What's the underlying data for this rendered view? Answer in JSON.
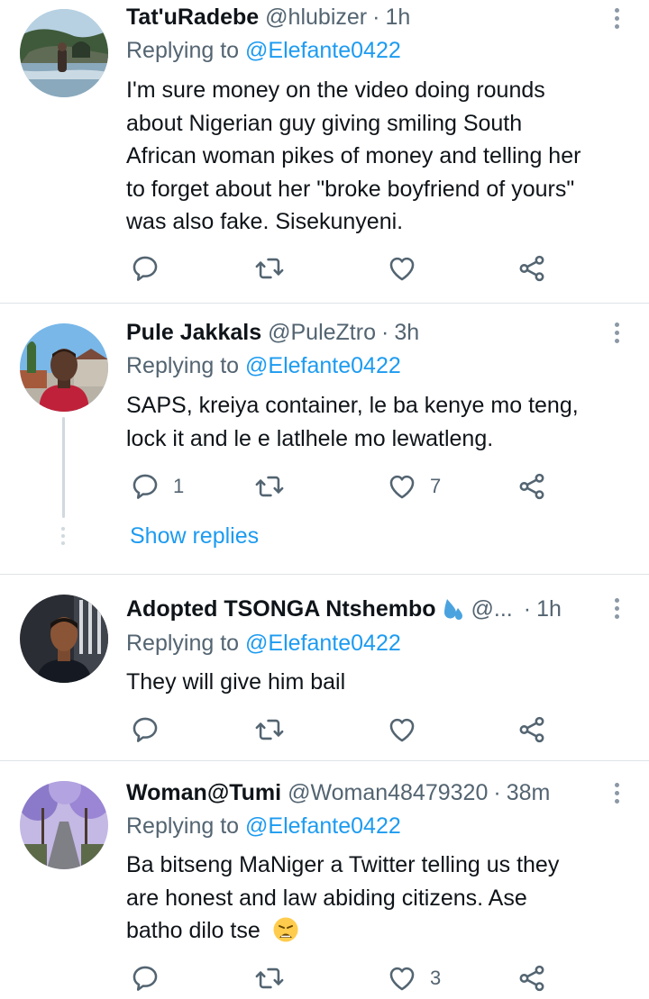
{
  "tweets": [
    {
      "name": "Tat'uRadebe",
      "handle": "@hlubizer",
      "separator": "·",
      "time": "1h",
      "replying_label": "Replying to",
      "replying_to": "@Elefante0422",
      "lines": [
        "I'm sure money on the video doing rounds",
        "about Nigerian guy giving smiling South",
        "African woman pikes of money and telling her",
        "to forget about her \"broke boyfriend of yours\"",
        "was also fake. Sisekunyeni."
      ],
      "reply_count": "",
      "like_count": ""
    },
    {
      "name": "Pule Jakkals",
      "handle": "@PuleZtro",
      "separator": "·",
      "time": "3h",
      "replying_label": "Replying to",
      "replying_to": "@Elefante0422",
      "lines": [
        "SAPS, kreiya container, le ba kenye mo teng,",
        "lock it and le e latlhele mo lewatleng."
      ],
      "reply_count": "1",
      "like_count": "7",
      "show_replies": "Show replies"
    },
    {
      "name": "Adopted TSONGA Ntshembo",
      "handle": "@...",
      "separator": "·",
      "time": "1h",
      "replying_label": "Replying to",
      "replying_to": "@Elefante0422",
      "lines": [
        "They will give him bail"
      ],
      "reply_count": "",
      "like_count": ""
    },
    {
      "name": "Woman@Tumi",
      "handle": "@Woman48479320",
      "separator": "·",
      "time": "38m",
      "replying_label": "Replying to",
      "replying_to": "@Elefante0422",
      "lines": [
        "Ba bitseng MaNiger a Twitter telling us they",
        "are honest and law abiding citizens.  Ase",
        "batho dilo tse"
      ],
      "reply_count": "",
      "like_count": "3"
    }
  ],
  "icons": {
    "reply": "reply-icon",
    "retweet": "retweet-icon",
    "like": "heart-icon",
    "share": "share-icon",
    "more": "more-options-icon"
  },
  "colors": {
    "accent": "#1d9bf0",
    "muted": "#536471",
    "text": "#0f1419",
    "divider": "#dfe3e6"
  }
}
